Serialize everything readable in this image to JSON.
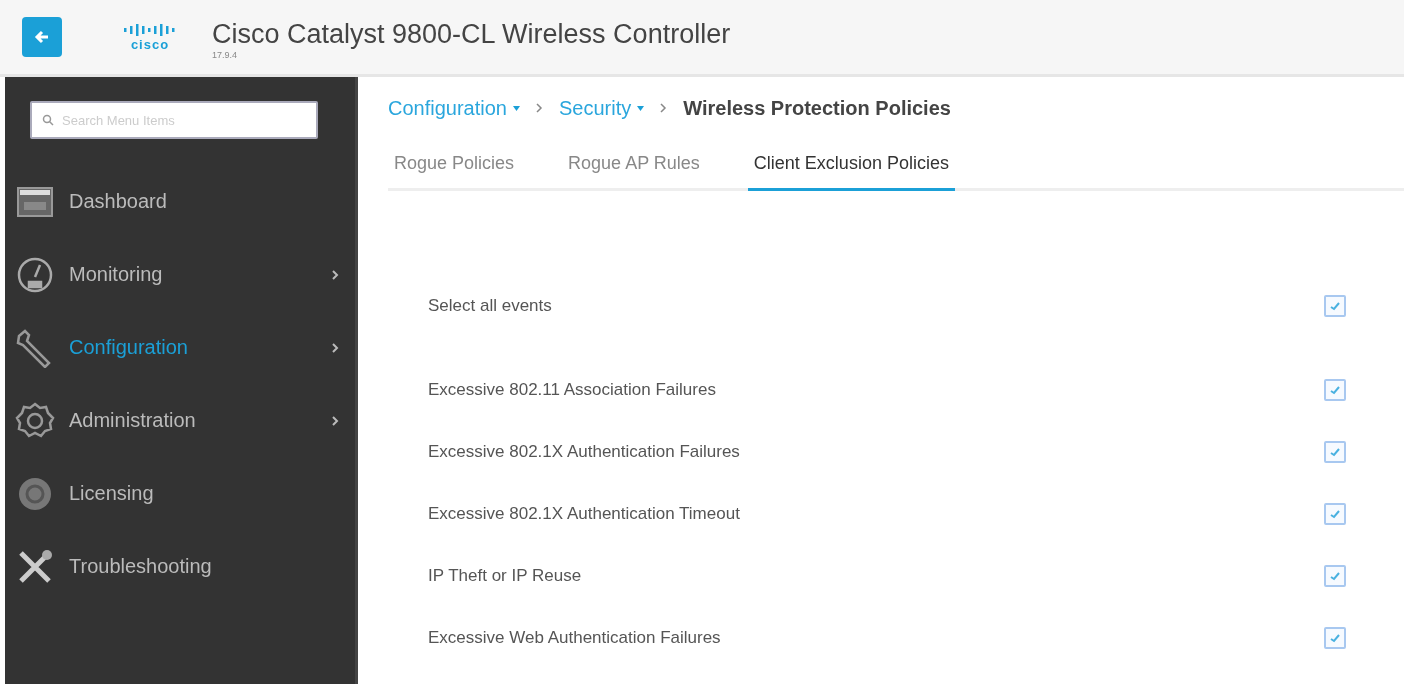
{
  "header": {
    "title": "Cisco Catalyst 9800-CL Wireless Controller",
    "version": "17.9.4",
    "logo_text": "cisco"
  },
  "sidebar": {
    "search": {
      "placeholder": "Search Menu Items"
    },
    "items": [
      {
        "label": "Dashboard",
        "selected": false,
        "has_submenu": false
      },
      {
        "label": "Monitoring",
        "selected": false,
        "has_submenu": true
      },
      {
        "label": "Configuration",
        "selected": true,
        "has_submenu": true
      },
      {
        "label": "Administration",
        "selected": false,
        "has_submenu": true
      },
      {
        "label": "Licensing",
        "selected": false,
        "has_submenu": false
      },
      {
        "label": "Troubleshooting",
        "selected": false,
        "has_submenu": false
      }
    ]
  },
  "breadcrumb": [
    {
      "label": "Configuration",
      "kind": "link"
    },
    {
      "label": "Security",
      "kind": "link"
    },
    {
      "label": "Wireless Protection Policies",
      "kind": "current"
    }
  ],
  "tabs": [
    {
      "label": "Rogue Policies",
      "selected": false
    },
    {
      "label": "Rogue AP Rules",
      "selected": false
    },
    {
      "label": "Client Exclusion Policies",
      "selected": true
    }
  ],
  "events": [
    {
      "label": "Select all events",
      "checked": true,
      "kind": "all"
    },
    {
      "label": "Excessive 802.11 Association Failures",
      "checked": true,
      "kind": "event"
    },
    {
      "label": "Excessive 802.1X Authentication Failures",
      "checked": true,
      "kind": "event"
    },
    {
      "label": "Excessive 802.1X Authentication Timeout",
      "checked": true,
      "kind": "event"
    },
    {
      "label": "IP Theft or IP Reuse",
      "checked": true,
      "kind": "event"
    },
    {
      "label": "Excessive Web Authentication Failures",
      "checked": true,
      "kind": "event"
    }
  ]
}
